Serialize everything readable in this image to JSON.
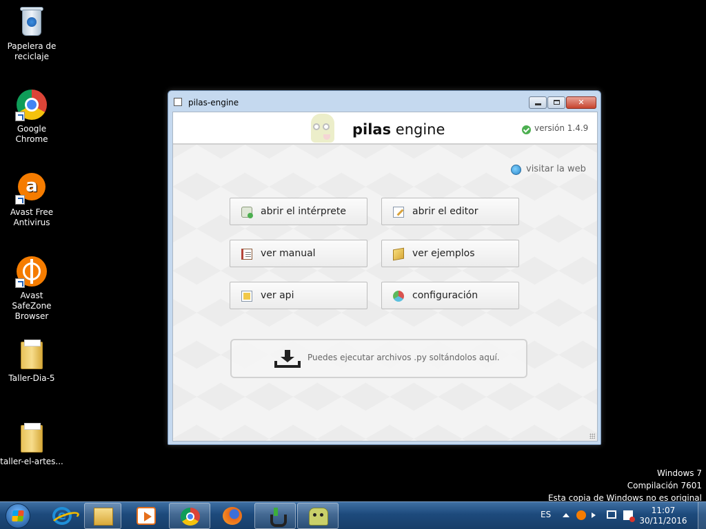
{
  "desktop": {
    "icons": [
      {
        "label_line1": "Papelera de",
        "label_line2": "reciclaje",
        "icon": "recycle-bin-icon"
      },
      {
        "label_line1": "Google Chrome",
        "label_line2": "",
        "icon": "chrome-icon"
      },
      {
        "label_line1": "Avast Free",
        "label_line2": "Antivirus",
        "icon": "avast-icon"
      },
      {
        "label_line1": "Avast SafeZone",
        "label_line2": "Browser",
        "icon": "safezone-icon"
      },
      {
        "label_line1": "Taller-Dia-5",
        "label_line2": "",
        "icon": "folder-icon"
      },
      {
        "label_line1": "taller-el-artes...",
        "label_line2": "",
        "icon": "folder-icon"
      }
    ]
  },
  "window": {
    "title": "pilas-engine",
    "brand_bold": "pilas",
    "brand_regular": " engine",
    "version": "versión 1.4.9",
    "visit_link": "visitar la web",
    "buttons": [
      {
        "label": "abrir el intérprete",
        "icon": "interpreter-icon"
      },
      {
        "label": "abrir el editor",
        "icon": "editor-icon"
      },
      {
        "label": "ver manual",
        "icon": "manual-icon"
      },
      {
        "label": "ver ejemplos",
        "icon": "examples-icon"
      },
      {
        "label": "ver api",
        "icon": "api-icon"
      },
      {
        "label": "configuración",
        "icon": "settings-icon"
      }
    ],
    "dropzone_text": "Puedes ejecutar archivos .py soltándolos aquí."
  },
  "watermark": {
    "line1": "Windows 7",
    "line2": "Compilación  7601",
    "line3": "Esta copia de Windows no es original"
  },
  "taskbar": {
    "pinned": [
      "internet-explorer-icon",
      "windows-explorer-icon",
      "media-player-icon",
      "chrome-icon",
      "firefox-icon",
      "git-icon",
      "pilas-engine-icon"
    ],
    "language": "ES",
    "time": "11:07",
    "date": "30/11/2016"
  }
}
